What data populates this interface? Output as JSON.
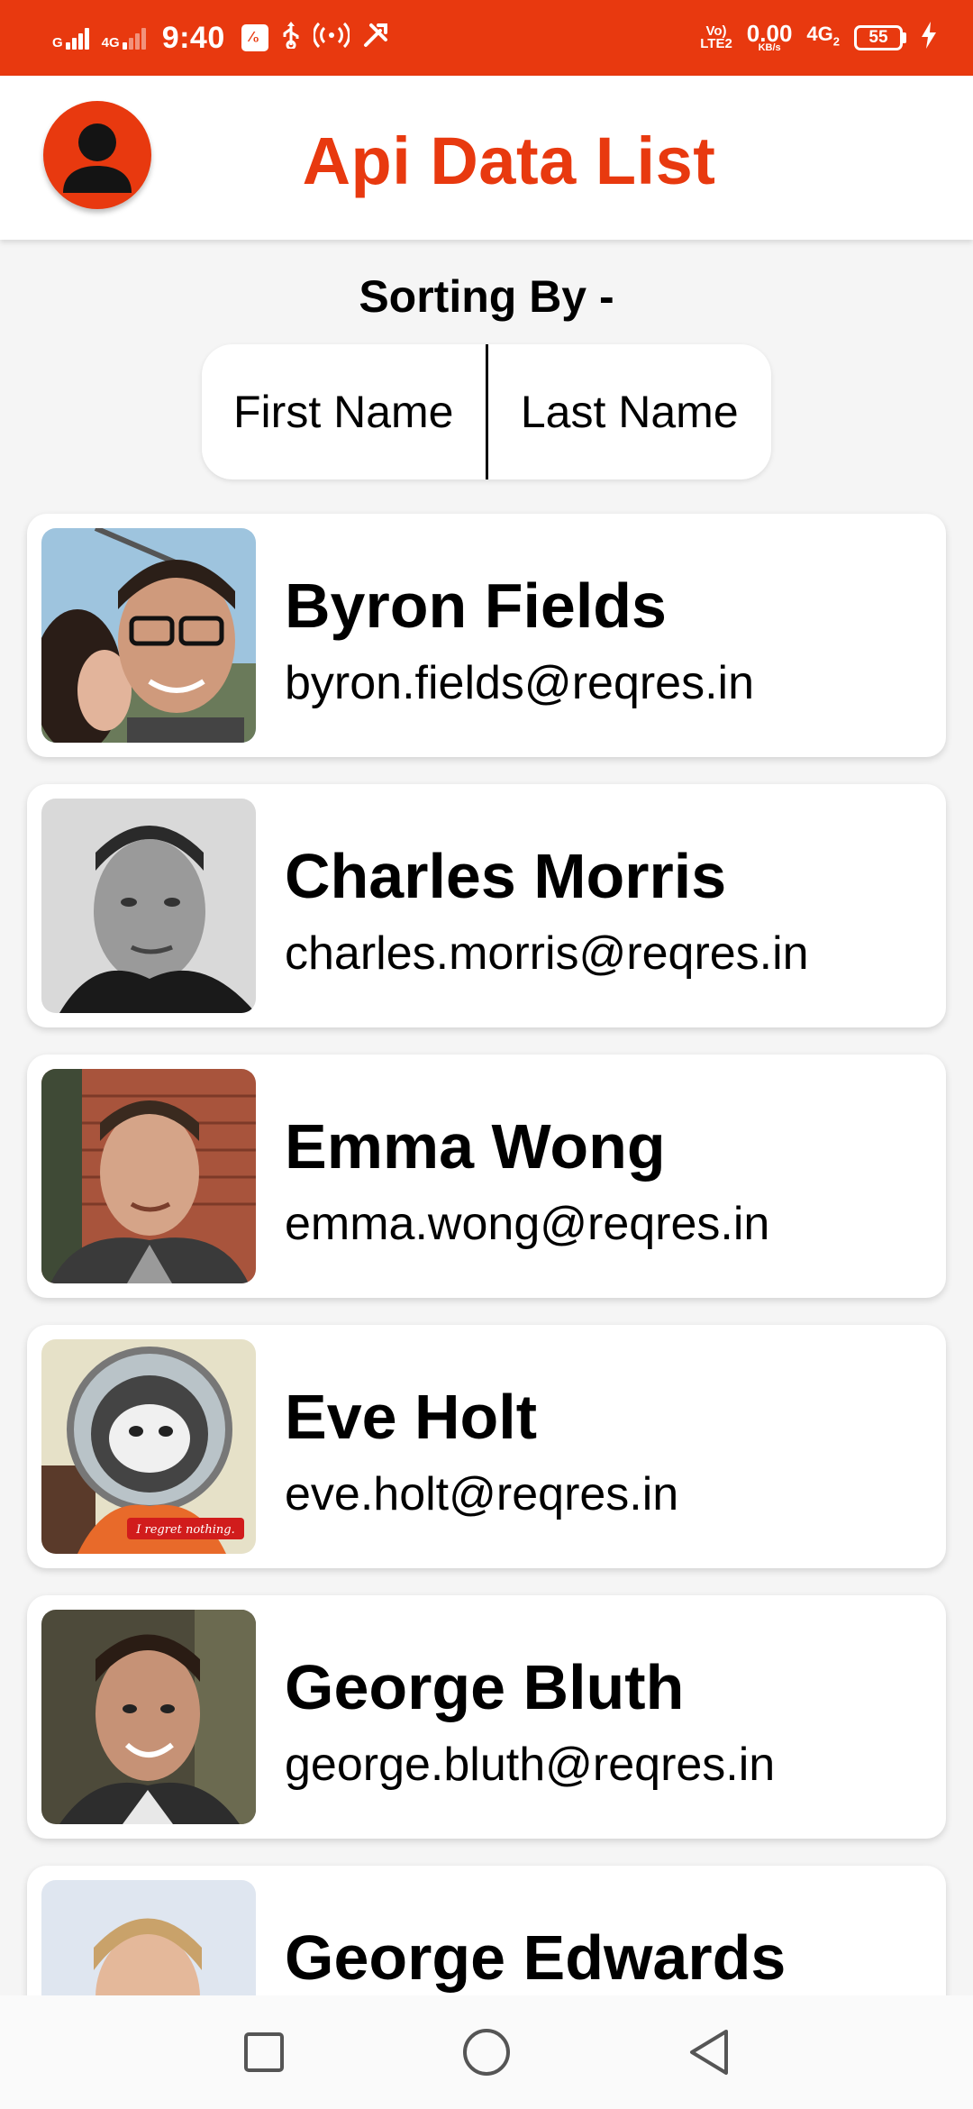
{
  "status_bar": {
    "sim1_label": "G",
    "sim1_sub": "4G",
    "time": "9:40",
    "box_icon_text": "⁄₀",
    "volte_top": "Vo)",
    "volte_bottom": "LTE2",
    "speed_value": "0.00",
    "speed_unit": "KB/s",
    "network_type": "4G",
    "network_sub": "2",
    "battery_level": "55"
  },
  "app_bar": {
    "title": "Api Data List"
  },
  "sorting": {
    "label": "Sorting By -",
    "options": [
      "First Name",
      "Last Name"
    ]
  },
  "users": [
    {
      "name": "Byron Fields",
      "email": "byron.fields@reqres.in"
    },
    {
      "name": "Charles Morris",
      "email": "charles.morris@reqres.in"
    },
    {
      "name": "Emma Wong",
      "email": "emma.wong@reqres.in"
    },
    {
      "name": "Eve Holt",
      "email": "eve.holt@reqres.in"
    },
    {
      "name": "George Bluth",
      "email": "george.bluth@reqres.in"
    },
    {
      "name": "George Edwards",
      "email": ""
    }
  ],
  "eve_photo_caption": "I regret nothing.",
  "colors": {
    "accent": "#e8390f",
    "background": "#f5f5f5",
    "card": "#ffffff"
  },
  "icons": {
    "profile": "user-silhouette-icon",
    "nav": [
      "recents-square-icon",
      "home-circle-icon",
      "back-triangle-icon"
    ]
  }
}
